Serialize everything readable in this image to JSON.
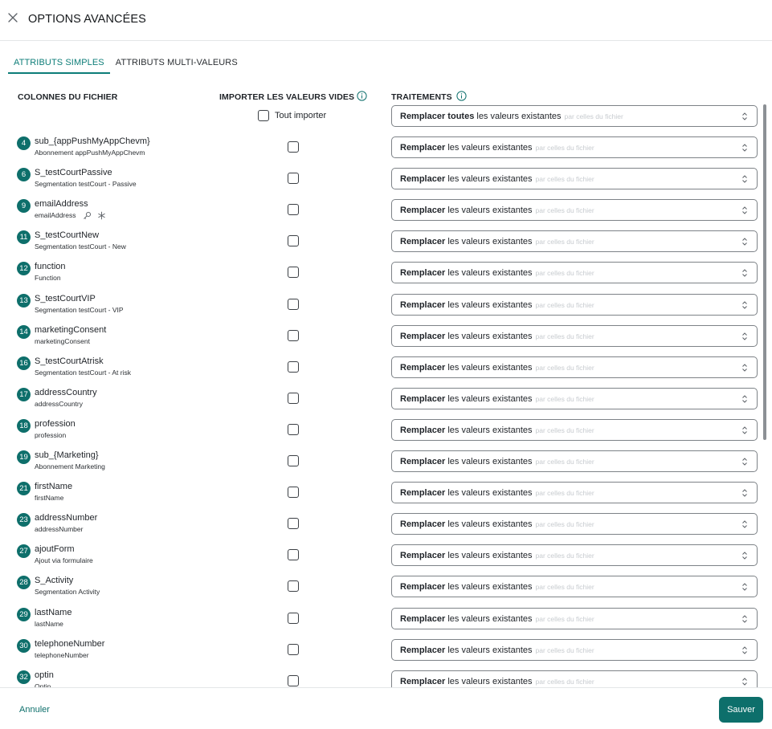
{
  "header": {
    "title": "OPTIONS AVANCÉES",
    "close_icon": "close-icon"
  },
  "tabs": [
    {
      "label": "ATTRIBUTS SIMPLES",
      "active": true
    },
    {
      "label": "ATTRIBUTS MULTI-VALEURS",
      "active": false
    }
  ],
  "columns": {
    "file_columns": "COLONNES DU FICHIER",
    "import_empty": "IMPORTER LES VALEURS VIDES",
    "treatments": "TRAITEMENTS"
  },
  "import_all": {
    "label": "Tout importer",
    "checked": false
  },
  "global_treatment": {
    "bold": "Remplacer toutes",
    "rest": "les valeurs existantes",
    "ghost": "par celles du fichier"
  },
  "row_treatment": {
    "bold": "Remplacer",
    "rest": "les valeurs existantes",
    "ghost": "par celles du fichier"
  },
  "rows": [
    {
      "index": "4",
      "name": "sub_{appPushMyAppChevm}",
      "label": "Abonnement appPushMyAppChevm"
    },
    {
      "index": "6",
      "name": "S_testCourtPassive",
      "label": "Segmentation testCourt - Passive"
    },
    {
      "index": "9",
      "name": "emailAddress",
      "label": "emailAddress",
      "key_icon": "key-icon",
      "required_icon": "asterisk-icon"
    },
    {
      "index": "11",
      "name": "S_testCourtNew",
      "label": "Segmentation testCourt - New"
    },
    {
      "index": "12",
      "name": "function",
      "label": "Function"
    },
    {
      "index": "13",
      "name": "S_testCourtVIP",
      "label": "Segmentation testCourt - VIP"
    },
    {
      "index": "14",
      "name": "marketingConsent",
      "label": "marketingConsent"
    },
    {
      "index": "16",
      "name": "S_testCourtAtrisk",
      "label": "Segmentation testCourt - At risk"
    },
    {
      "index": "17",
      "name": "addressCountry",
      "label": "addressCountry"
    },
    {
      "index": "18",
      "name": "profession",
      "label": "profession"
    },
    {
      "index": "19",
      "name": "sub_{Marketing}",
      "label": "Abonnement Marketing"
    },
    {
      "index": "21",
      "name": "firstName",
      "label": "firstName"
    },
    {
      "index": "23",
      "name": "addressNumber",
      "label": "addressNumber"
    },
    {
      "index": "27",
      "name": "ajoutForm",
      "label": "Ajout via formulaire"
    },
    {
      "index": "28",
      "name": "S_Activity",
      "label": "Segmentation Activity"
    },
    {
      "index": "29",
      "name": "lastName",
      "label": "lastName"
    },
    {
      "index": "30",
      "name": "telephoneNumber",
      "label": "telephoneNumber"
    },
    {
      "index": "32",
      "name": "optin",
      "label": "Optin"
    }
  ],
  "footer": {
    "cancel": "Annuler",
    "save": "Sauver"
  },
  "colors": {
    "accent": "#0d6f6b",
    "badge": "#0e6f6b",
    "border": "#7d8287"
  }
}
